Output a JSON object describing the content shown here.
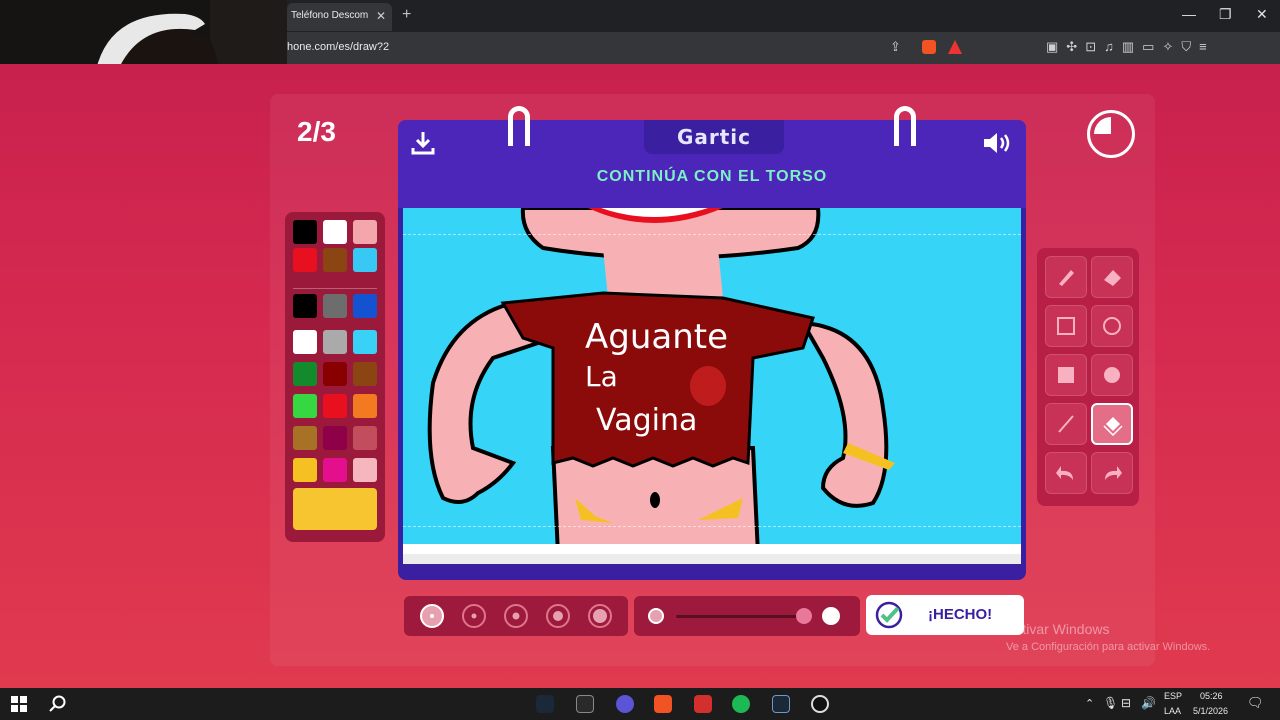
{
  "browser": {
    "tab_title": "Teléfono Descom",
    "new_tab": "+",
    "url": "hone.com/es/draw?2"
  },
  "game": {
    "round": "2/3",
    "logo": "Gartic",
    "prompt": "CONTINÚA CON EL TORSO",
    "shirt_text": [
      "Aguante",
      "La",
      "Vagina"
    ],
    "done_label": "¡HECHO!",
    "palette": [
      "#000000",
      "#ffffff",
      "#f4a6ad",
      "#e8101e",
      "#8b4512",
      "#38c8f4",
      "#000000",
      "#6d6d6d",
      "#1353d1",
      "#ffffff",
      "#aaaaaa",
      "#3ad1f7",
      "#138a2b",
      "#880000",
      "#8a4513",
      "#35d840",
      "#e8101e",
      "#f47a22",
      "#a87226",
      "#8e0047",
      "#c24d5d",
      "#f5c122",
      "#e40f8d",
      "#f5b6bd"
    ],
    "current_color": "#f7c52f",
    "tools": [
      "pencil-icon",
      "eraser-icon",
      "square-outline-icon",
      "circle-outline-icon",
      "square-filled-icon",
      "circle-filled-icon",
      "line-icon",
      "fill-bucket-icon",
      "undo-icon",
      "redo-icon"
    ],
    "selected_tool": "fill-bucket-icon"
  },
  "windows": {
    "activate_title": "Activar Windows",
    "activate_sub": "Ve a Configuración para activar Windows.",
    "lang1": "ESP",
    "lang2": "LAA",
    "time": "05:26",
    "date": "5/1/2026"
  }
}
